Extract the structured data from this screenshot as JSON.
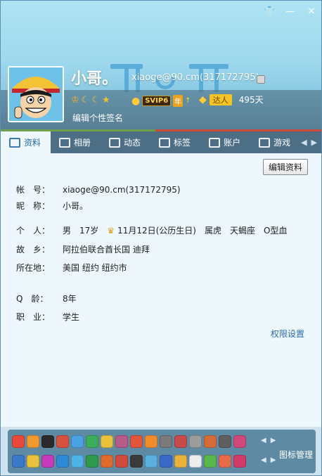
{
  "window": {
    "controls": [
      "👕",
      "—",
      "✕"
    ]
  },
  "profile": {
    "nickname": "小哥。",
    "account": "xiaoge@90.cm(317172795)",
    "svip": "SVIP6",
    "svip_year": "年",
    "daren_tag": "达人",
    "daren_days": "495天",
    "signature": "编辑个性签名"
  },
  "tabs": [
    {
      "label": "资料",
      "active": true
    },
    {
      "label": "相册"
    },
    {
      "label": "动态"
    },
    {
      "label": "标签"
    },
    {
      "label": "账户"
    },
    {
      "label": "游戏"
    }
  ],
  "content": {
    "edit_button": "编辑资料",
    "fields": {
      "account_label": "帐　号：",
      "account_value": "xiaoge@90.cm(317172795)",
      "nickname_label": "昵　称：",
      "nickname_value": "小哥。",
      "personal_label": "个　人：",
      "gender": "男",
      "age": "17岁",
      "birthday": "11月12日(公历生日)",
      "zodiac_cn": "属虎",
      "zodiac": "天蝎座",
      "blood": "O型血",
      "hometown_label": "故　乡：",
      "hometown_value": "阿拉伯联合酋长国 迪拜",
      "location_label": "所在地：",
      "location_value": "美国 纽约 纽约市",
      "qage_label": "Q　龄：",
      "qage_value": "8年",
      "job_label": "职　业：",
      "job_value": "学生"
    },
    "permission_link": "权限设置"
  },
  "bottom": {
    "icon_manage": "图标管理"
  },
  "colors": {
    "accent": "#2d6eb0",
    "tab_bar": "#4c6f86"
  }
}
